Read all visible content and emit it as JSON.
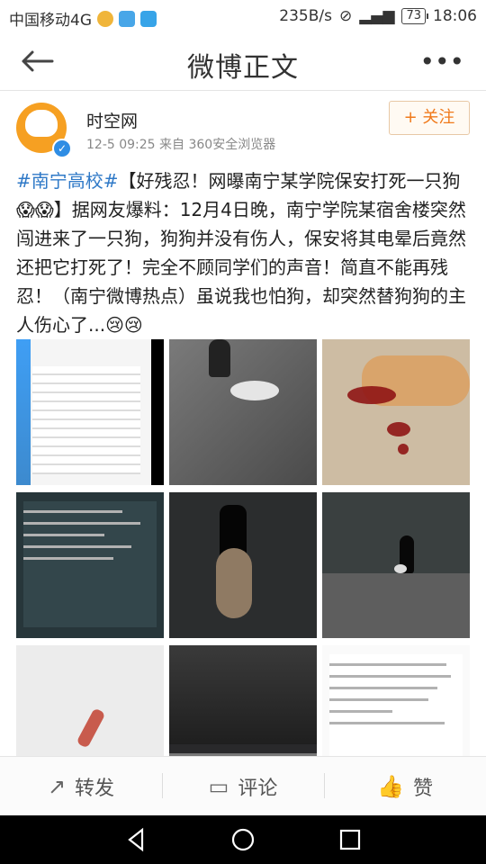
{
  "status_bar": {
    "carrier": "中国移动4G",
    "network_speed": "235B/s",
    "battery": "73",
    "time": "18:06"
  },
  "nav": {
    "title": "微博正文",
    "more": "•••"
  },
  "post": {
    "username": "时空网",
    "meta": "12-5 09:25   来自 360安全浏览器",
    "follow_label": "+ 关注",
    "hashtag": "#南宁高校#",
    "body": "【好残忍！网曝南宁某学院保安打死一只狗😱😱】据网友爆料：12月4日晚，南宁学院某宿舍楼突然闯进来了一只狗，狗狗并没有伤人，保安将其电晕后竟然还把它打死了！完全不顾同学们的声音！简直不能再残忍！（南宁微博热点）虽说我也怕狗，却突然替狗狗的主人伤心了...😢😢"
  },
  "images": [
    {
      "name": "image-1"
    },
    {
      "name": "image-2"
    },
    {
      "name": "image-3"
    },
    {
      "name": "image-4"
    },
    {
      "name": "image-5"
    },
    {
      "name": "image-6"
    },
    {
      "name": "image-7"
    },
    {
      "name": "image-8"
    },
    {
      "name": "image-9"
    }
  ],
  "actions": {
    "repost": "转发",
    "comment": "评论",
    "like": "赞"
  }
}
